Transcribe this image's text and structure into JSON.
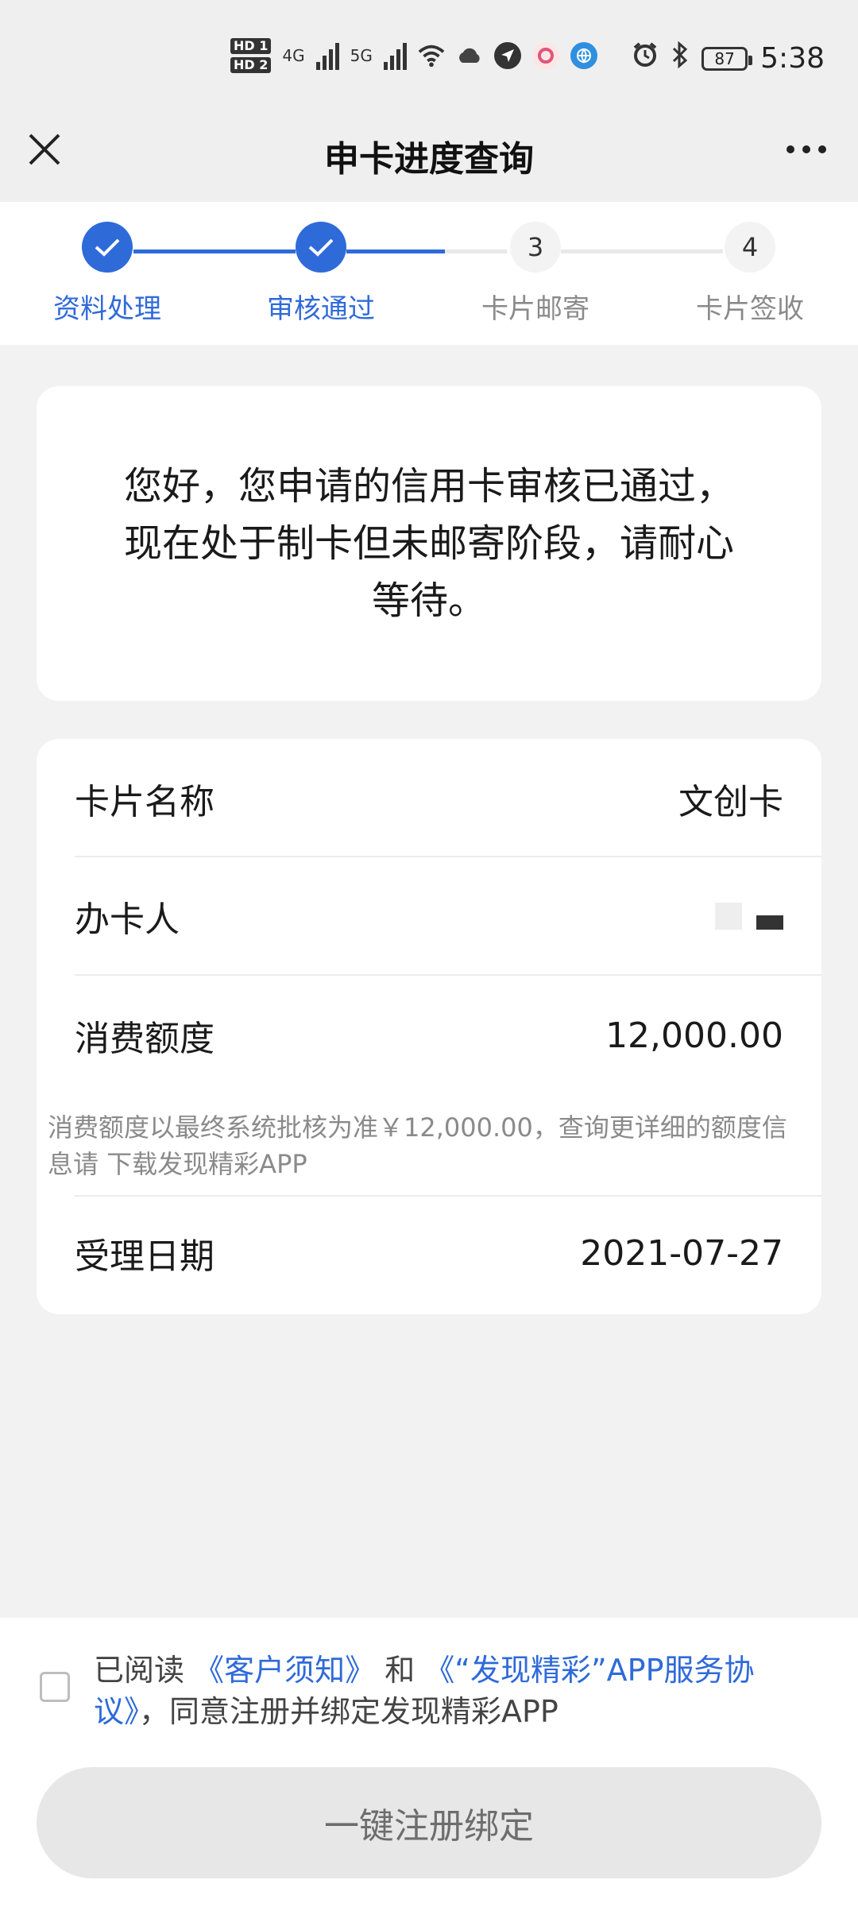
{
  "status_bar": {
    "hd1": "HD 1",
    "hd2": "HD 2",
    "net1": "4G",
    "net2": "5G",
    "battery": "87",
    "time": "5:38"
  },
  "nav": {
    "title": "申卡进度查询"
  },
  "steps": [
    {
      "num": "",
      "label": "资料处理",
      "state": "done"
    },
    {
      "num": "",
      "label": "审核通过",
      "state": "done"
    },
    {
      "num": "3",
      "label": "卡片邮寄",
      "state": "todo"
    },
    {
      "num": "4",
      "label": "卡片签收",
      "state": "todo"
    }
  ],
  "message": "您好，您申请的信用卡审核已通过，现在处于制卡但未邮寄阶段，请耐心等待。",
  "info": {
    "card_name_label": "卡片名称",
    "card_name_value": "文创卡",
    "applicant_label": "办卡人",
    "limit_label": "消费额度",
    "limit_value": "12,000.00",
    "limit_note": "消费额度以最终系统批核为准￥12,000.00，查询更详细的额度信息请 下载发现精彩APP",
    "date_label": "受理日期",
    "date_value": "2021-07-27"
  },
  "agreement": {
    "prefix": "已阅读 ",
    "link1": "《客户须知》",
    "mid": " 和 ",
    "link2": "《“发现精彩”APP服务协议》",
    "suffix": "，同意注册并绑定发现精彩APP"
  },
  "button_label": "一键注册绑定",
  "colors": {
    "accent": "#2f6ad9",
    "muted": "#8a8a8a"
  }
}
